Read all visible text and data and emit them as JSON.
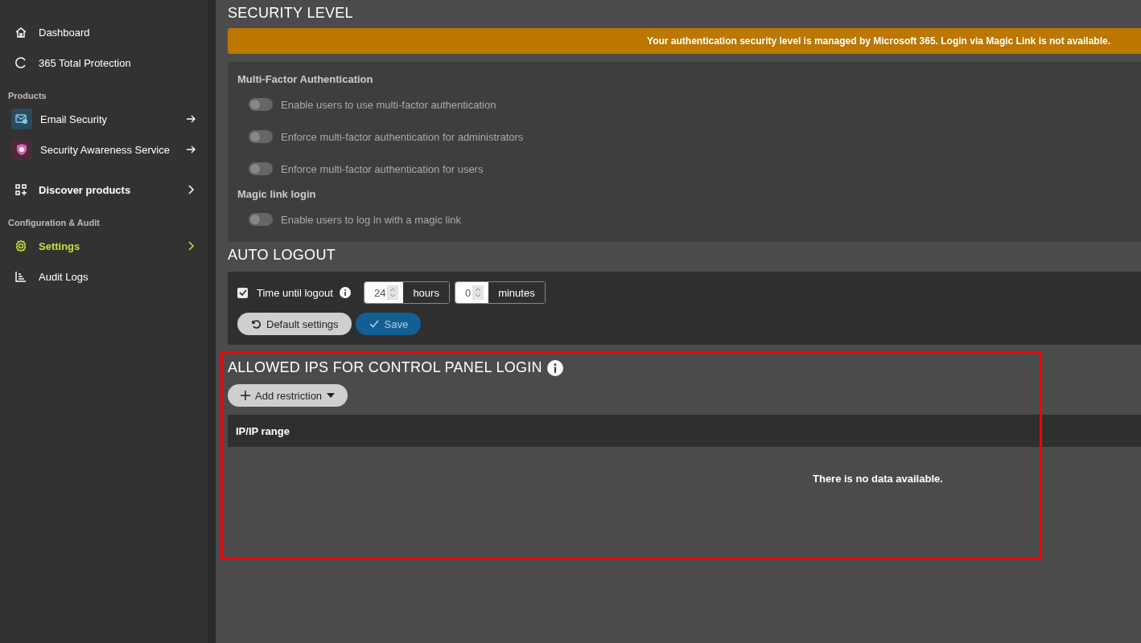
{
  "sidebar": {
    "groups": [
      {
        "items": [
          {
            "label": "Dashboard",
            "kind": "plain",
            "selected": false
          },
          {
            "label": "365 Total Protection",
            "kind": "plain",
            "selected": false
          }
        ]
      },
      {
        "heading": "Products",
        "items": [
          {
            "label": "Email Security",
            "kind": "product",
            "selected": false,
            "color": "#2b4a5e"
          },
          {
            "label": "Security Awareness Service",
            "kind": "product",
            "selected": false,
            "color": "#4a2a3c"
          },
          {
            "label": "Discover products",
            "kind": "expandable",
            "selected": false
          }
        ]
      },
      {
        "heading": "Configuration & Audit",
        "items": [
          {
            "label": "Settings",
            "kind": "expandable",
            "selected": true
          },
          {
            "label": "Audit Logs",
            "kind": "plain",
            "selected": false
          }
        ]
      }
    ]
  },
  "security_level": {
    "title": "SECURITY LEVEL",
    "notice": "Your authentication security level is managed by Microsoft 365. Login via Magic Link is not available.",
    "groups": [
      {
        "heading": "Multi-Factor Authentication",
        "toggles": [
          {
            "label": "Enable users to use multi-factor authentication",
            "on": false
          },
          {
            "label": "Enforce multi-factor authentication for administrators",
            "on": false
          },
          {
            "label": "Enforce multi-factor authentication for users",
            "on": false
          }
        ]
      },
      {
        "heading": "Magic link login",
        "toggles": [
          {
            "label": "Enable users to log in with a magic link",
            "on": false
          }
        ]
      }
    ]
  },
  "auto_logout": {
    "title": "AUTO LOGOUT",
    "checkbox": {
      "label": "Time until logout",
      "checked": true
    },
    "fields": [
      {
        "value": "24",
        "unit": "hours"
      },
      {
        "value": "0",
        "unit": "minutes"
      }
    ],
    "buttons": [
      {
        "label": "Default settings",
        "kind": "reset"
      },
      {
        "label": "Save",
        "kind": "save"
      }
    ]
  },
  "allowed_ips": {
    "title": "ALLOWED IPS FOR CONTROL PANEL LOGIN",
    "add_button": "Add restriction",
    "table": {
      "columns": [
        "IP/IP range"
      ],
      "empty_message": "There is no data available."
    }
  }
}
